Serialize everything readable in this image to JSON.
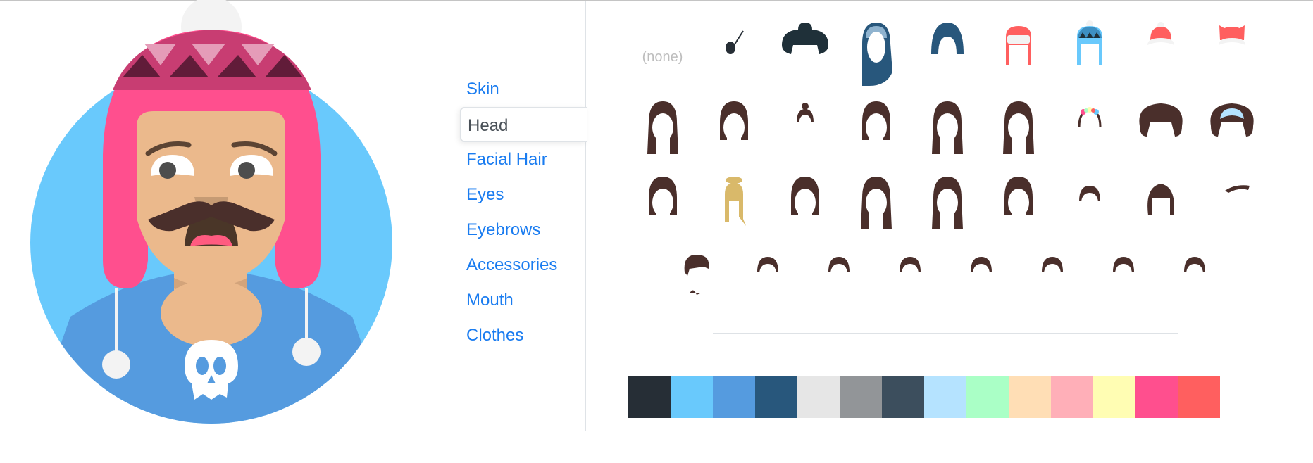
{
  "nav": {
    "items": [
      {
        "label": "Skin",
        "active": false
      },
      {
        "label": "Head",
        "active": true
      },
      {
        "label": "Facial Hair",
        "active": false
      },
      {
        "label": "Eyes",
        "active": false
      },
      {
        "label": "Eyebrows",
        "active": false
      },
      {
        "label": "Accessories",
        "active": false
      },
      {
        "label": "Mouth",
        "active": false
      },
      {
        "label": "Clothes",
        "active": false
      }
    ]
  },
  "options": {
    "none_label": "(none)",
    "rows": [
      [
        "none",
        "eyepatch",
        "wide-hat",
        "hijab",
        "turban",
        "winter-hat-red",
        "winter-hat-blue",
        "beanie-red",
        "cat-beanie"
      ],
      [
        "wavy-long",
        "bob",
        "bun",
        "curly-bob",
        "curly-long",
        "dreads",
        "flower-crown",
        "afro",
        "afro-headband"
      ],
      [
        "short-bob",
        "blonde-bun",
        "bangs-bob",
        "long-straight",
        "long-side",
        "medium",
        "short-spiky",
        "curly-short",
        "side-swoop"
      ],
      [
        "messy",
        "short-1",
        "short-2",
        "short-3",
        "quiff",
        "buzz",
        "short-4",
        "short-5"
      ]
    ],
    "hair_color": "#4a2f2b"
  },
  "colors": [
    "#262e36",
    "#69c9fc",
    "#559bdf",
    "#28577c",
    "#e6e6e6",
    "#929598",
    "#3c4e5d",
    "#b5e3ff",
    "#aaffc6",
    "#ffdeb5",
    "#ffafb8",
    "#fffdb3",
    "#ff4f8e",
    "#ff5f5f"
  ],
  "avatar": {
    "background": "#69c9fc",
    "skin": "#ebb98c",
    "hat": "#ff4f8e",
    "shirt": "#559bdf"
  }
}
